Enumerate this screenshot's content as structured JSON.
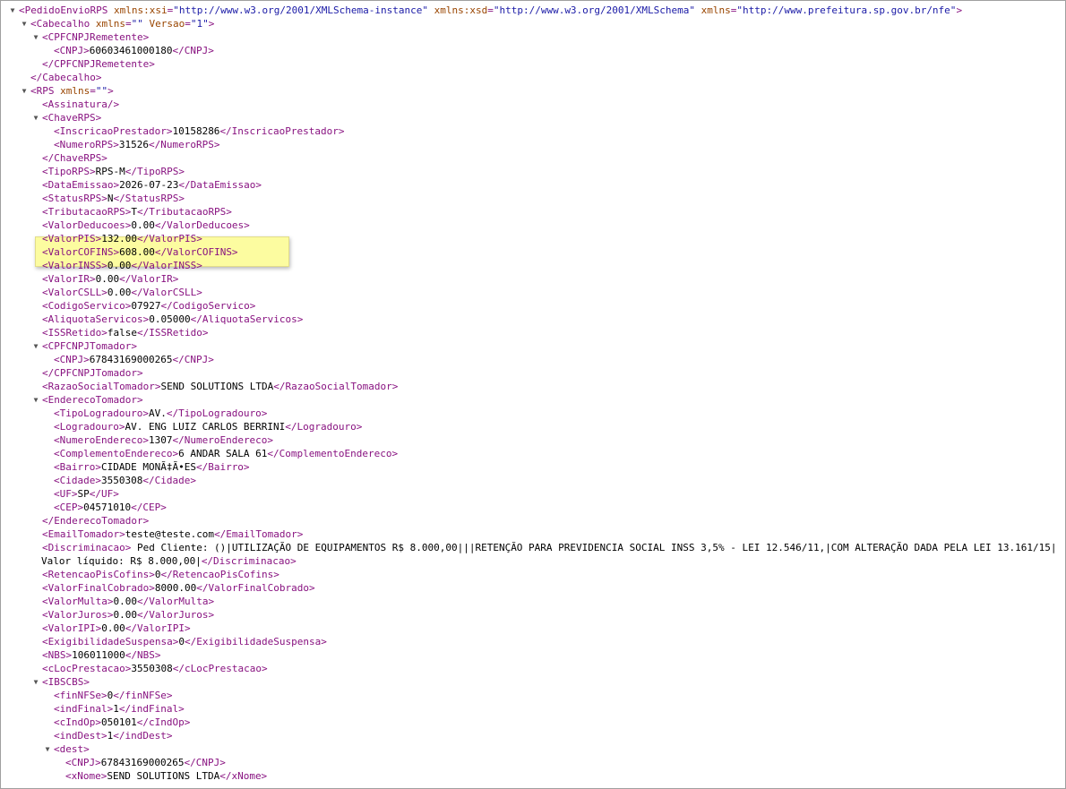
{
  "viewer": {
    "lines": [
      {
        "indent": 0,
        "toggle": true,
        "kind": "open",
        "tag": "PedidoEnvioRPS",
        "attrs": [
          {
            "name": "xmlns:xsi",
            "value": "\"http://www.w3.org/2001/XMLSchema-instance\""
          },
          {
            "name": "xmlns:xsd",
            "value": "\"http://www.w3.org/2001/XMLSchema\""
          },
          {
            "name": "xmlns",
            "value": "\"http://www.prefeitura.sp.gov.br/nfe\""
          }
        ]
      },
      {
        "indent": 1,
        "toggle": true,
        "kind": "open",
        "tag": "Cabecalho",
        "attrs": [
          {
            "name": "xmlns",
            "value": "\"\""
          },
          {
            "name": "Versao",
            "value": "\"1\""
          }
        ]
      },
      {
        "indent": 2,
        "toggle": true,
        "kind": "open",
        "tag": "CPFCNPJRemetente"
      },
      {
        "indent": 3,
        "kind": "leaf",
        "tag": "CNPJ",
        "text": "60603461000180"
      },
      {
        "indent": 2,
        "kind": "close",
        "tag": "CPFCNPJRemetente"
      },
      {
        "indent": 1,
        "kind": "close",
        "tag": "Cabecalho"
      },
      {
        "indent": 1,
        "toggle": true,
        "kind": "open",
        "tag": "RPS",
        "attrs": [
          {
            "name": "xmlns",
            "value": "\"\""
          }
        ]
      },
      {
        "indent": 2,
        "kind": "empty",
        "tag": "Assinatura"
      },
      {
        "indent": 2,
        "toggle": true,
        "kind": "open",
        "tag": "ChaveRPS"
      },
      {
        "indent": 3,
        "kind": "leaf",
        "tag": "InscricaoPrestador",
        "text": "10158286"
      },
      {
        "indent": 3,
        "kind": "leaf",
        "tag": "NumeroRPS",
        "text": "31526"
      },
      {
        "indent": 2,
        "kind": "close",
        "tag": "ChaveRPS"
      },
      {
        "indent": 2,
        "kind": "leaf",
        "tag": "TipoRPS",
        "text": "RPS-M"
      },
      {
        "indent": 2,
        "kind": "leaf",
        "tag": "DataEmissao",
        "text": "2026-07-23"
      },
      {
        "indent": 2,
        "kind": "leaf",
        "tag": "StatusRPS",
        "text": "N"
      },
      {
        "indent": 2,
        "kind": "leaf",
        "tag": "TributacaoRPS",
        "text": "T"
      },
      {
        "indent": 2,
        "kind": "leaf",
        "tag": "ValorDeducoes",
        "text": "0.00"
      },
      {
        "indent": 2,
        "kind": "leaf",
        "tag": "ValorPIS",
        "text": "132.00"
      },
      {
        "indent": 2,
        "kind": "leaf",
        "tag": "ValorCOFINS",
        "text": "608.00"
      },
      {
        "indent": 2,
        "kind": "leaf",
        "tag": "ValorINSS",
        "text": "0.00"
      },
      {
        "indent": 2,
        "kind": "leaf",
        "tag": "ValorIR",
        "text": "0.00"
      },
      {
        "indent": 2,
        "kind": "leaf",
        "tag": "ValorCSLL",
        "text": "0.00"
      },
      {
        "indent": 2,
        "kind": "leaf",
        "tag": "CodigoServico",
        "text": "07927"
      },
      {
        "indent": 2,
        "kind": "leaf",
        "tag": "AliquotaServicos",
        "text": "0.05000"
      },
      {
        "indent": 2,
        "kind": "leaf",
        "tag": "ISSRetido",
        "text": "false"
      },
      {
        "indent": 2,
        "toggle": true,
        "kind": "open",
        "tag": "CPFCNPJTomador"
      },
      {
        "indent": 3,
        "kind": "leaf",
        "tag": "CNPJ",
        "text": "67843169000265"
      },
      {
        "indent": 2,
        "kind": "close",
        "tag": "CPFCNPJTomador"
      },
      {
        "indent": 2,
        "kind": "leaf",
        "tag": "RazaoSocialTomador",
        "text": "SEND SOLUTIONS LTDA"
      },
      {
        "indent": 2,
        "toggle": true,
        "kind": "open",
        "tag": "EnderecoTomador"
      },
      {
        "indent": 3,
        "kind": "leaf",
        "tag": "TipoLogradouro",
        "text": "AV."
      },
      {
        "indent": 3,
        "kind": "leaf",
        "tag": "Logradouro",
        "text": "AV. ENG LUIZ CARLOS BERRINI"
      },
      {
        "indent": 3,
        "kind": "leaf",
        "tag": "NumeroEndereco",
        "text": "1307"
      },
      {
        "indent": 3,
        "kind": "leaf",
        "tag": "ComplementoEndereco",
        "text": "6 ANDAR SALA 61"
      },
      {
        "indent": 3,
        "kind": "leaf",
        "tag": "Bairro",
        "text": "CIDADE MONÃ‡Ã•ES"
      },
      {
        "indent": 3,
        "kind": "leaf",
        "tag": "Cidade",
        "text": "3550308"
      },
      {
        "indent": 3,
        "kind": "leaf",
        "tag": "UF",
        "text": "SP"
      },
      {
        "indent": 3,
        "kind": "leaf",
        "tag": "CEP",
        "text": "04571010"
      },
      {
        "indent": 2,
        "kind": "close",
        "tag": "EnderecoTomador"
      },
      {
        "indent": 2,
        "kind": "leaf",
        "tag": "EmailTomador",
        "text": "teste@teste.com"
      },
      {
        "indent": 2,
        "kind": "opentext",
        "tag": "Discriminacao",
        "text": " Ped Cliente: ()|UTILIZAÇÃO DE EQUIPAMENTOS R$ 8.000,00|||RETENÇÃO PARA PREVIDENCIA SOCIAL INSS 3,5% - LEI 12.546/11,|COM ALTERAÇÃO DADA PELA LEI 13.161/15|"
      },
      {
        "indent": 2,
        "kind": "textclose",
        "tag": "Discriminacao",
        "text": "Valor líquido: R$ 8.000,00|"
      },
      {
        "indent": 2,
        "kind": "leaf",
        "tag": "RetencaoPisCofins",
        "text": "0"
      },
      {
        "indent": 2,
        "kind": "leaf",
        "tag": "ValorFinalCobrado",
        "text": "8000.00"
      },
      {
        "indent": 2,
        "kind": "leaf",
        "tag": "ValorMulta",
        "text": "0.00"
      },
      {
        "indent": 2,
        "kind": "leaf",
        "tag": "ValorJuros",
        "text": "0.00"
      },
      {
        "indent": 2,
        "kind": "leaf",
        "tag": "ValorIPI",
        "text": "0.00"
      },
      {
        "indent": 2,
        "kind": "leaf",
        "tag": "ExigibilidadeSuspensa",
        "text": "0"
      },
      {
        "indent": 2,
        "kind": "leaf",
        "tag": "NBS",
        "text": "106011000"
      },
      {
        "indent": 2,
        "kind": "leaf",
        "tag": "cLocPrestacao",
        "text": "3550308"
      },
      {
        "indent": 2,
        "toggle": true,
        "kind": "open",
        "tag": "IBSCBS"
      },
      {
        "indent": 3,
        "kind": "leaf",
        "tag": "finNFSe",
        "text": "0"
      },
      {
        "indent": 3,
        "kind": "leaf",
        "tag": "indFinal",
        "text": "1"
      },
      {
        "indent": 3,
        "kind": "leaf",
        "tag": "cIndOp",
        "text": "050101"
      },
      {
        "indent": 3,
        "kind": "leaf",
        "tag": "indDest",
        "text": "1"
      },
      {
        "indent": 3,
        "toggle": true,
        "kind": "open",
        "tag": "dest"
      },
      {
        "indent": 4,
        "kind": "leaf",
        "tag": "CNPJ",
        "text": "67843169000265"
      },
      {
        "indent": 4,
        "kind": "leaf",
        "tag": "xNome",
        "text": "SEND SOLUTIONS LTDA"
      }
    ]
  }
}
